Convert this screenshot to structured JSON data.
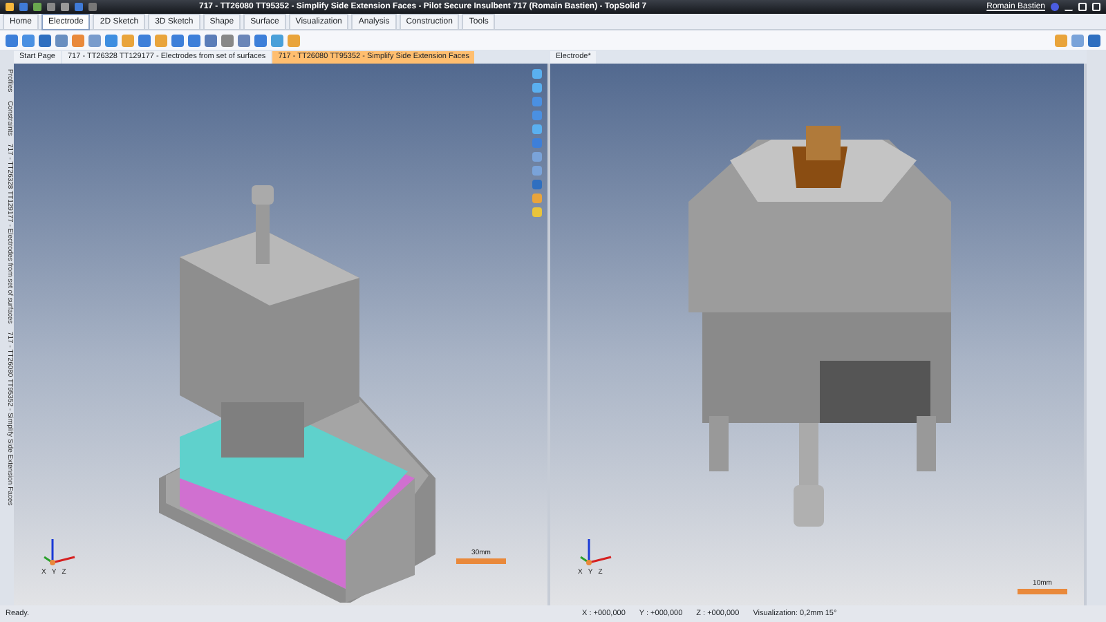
{
  "window": {
    "title": "717 - TT26080 TT95352 - Simplify Side Extension Faces - Pilot Secure Insulbent 717 (Romain Bastien) - TopSolid 7",
    "user": "Romain Bastien"
  },
  "ribbon_tabs": [
    {
      "label": "Home",
      "selected": false
    },
    {
      "label": "Electrode",
      "selected": true
    },
    {
      "label": "2D Sketch",
      "selected": false
    },
    {
      "label": "3D Sketch",
      "selected": false
    },
    {
      "label": "Shape",
      "selected": false
    },
    {
      "label": "Surface",
      "selected": false
    },
    {
      "label": "Visualization",
      "selected": false
    },
    {
      "label": "Analysis",
      "selected": false
    },
    {
      "label": "Construction",
      "selected": false
    },
    {
      "label": "Tools",
      "selected": false
    }
  ],
  "side_tabs": [
    {
      "label": "Profiles"
    },
    {
      "label": "Constraints"
    },
    {
      "label": "717 - TT26328 TT129177 - Electrodes from set of surfaces"
    },
    {
      "label": "717 - TT26080 TT95352 - Simplify Side Extension Faces"
    }
  ],
  "document_tabs": [
    {
      "label": "Start Page",
      "selected": false
    },
    {
      "label": "717 - TT26328 TT129177 - Electrodes from set of surfaces",
      "selected": false
    },
    {
      "label": "717 - TT26080 TT95352 - Simplify Side Extension Faces",
      "selected": true
    }
  ],
  "viewports": [
    {
      "scale": "30mm",
      "axes": [
        "X",
        "Y",
        "Z"
      ]
    },
    {
      "tab": "Electrode*",
      "scale": "10mm",
      "axes": [
        "X",
        "Y",
        "Z"
      ]
    }
  ],
  "status_bar": {
    "message": "Ready.",
    "x": "X : +000,000",
    "y": "Y : +000,000",
    "z": "Z : +000,000",
    "visualization": "Visualization: 0,2mm 15°"
  }
}
